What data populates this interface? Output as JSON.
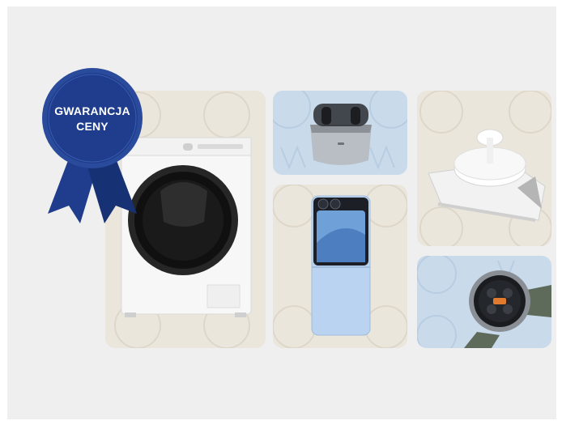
{
  "badge": {
    "line1": "GWARANCJA",
    "line2": "CENY",
    "color": "#1f3d8c"
  },
  "products": [
    {
      "icon": "washing-machine-icon",
      "card": "beige"
    },
    {
      "icon": "earbuds-icon",
      "card": "blue"
    },
    {
      "icon": "robot-vacuum-icon",
      "card": "beige"
    },
    {
      "icon": "flip-phone-icon",
      "card": "beige"
    },
    {
      "icon": "smartwatch-icon",
      "card": "blue"
    }
  ],
  "colors": {
    "background": "#efefef",
    "card_beige": "#ebe6dc",
    "card_blue": "#c9dbeb",
    "badge_blue": "#1f3d8c"
  }
}
